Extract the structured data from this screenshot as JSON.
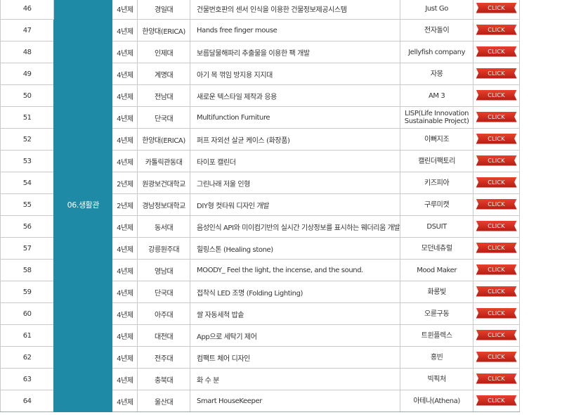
{
  "category": "06.생활관",
  "button_label": "CLICK",
  "rows": [
    {
      "no": "46",
      "grade": "4년제",
      "school": "경일대",
      "title": "건물번호판의 센서 인식을 이용한 건물정보제공시스템",
      "team": "Just Go"
    },
    {
      "no": "47",
      "grade": "4년제",
      "school": "한양대(ERICA)",
      "title": "Hands free finger mouse",
      "team": "전자돌이"
    },
    {
      "no": "48",
      "grade": "4년제",
      "school": "인제대",
      "title": "보름달물해파리 추출물을 이용한 팩 개발",
      "team": "Jellyfish company"
    },
    {
      "no": "49",
      "grade": "4년제",
      "school": "계명대",
      "title": "아기 목 꺾임 방지용 지지대",
      "team": "자몽"
    },
    {
      "no": "50",
      "grade": "4년제",
      "school": "전남대",
      "title": "새로운 텍스타일 제작과 응용",
      "team": "AM 3"
    },
    {
      "no": "51",
      "grade": "4년제",
      "school": "단국대",
      "title": "Multifunction Furniture",
      "team": "LISP(Life Innovation Sustainable Project)"
    },
    {
      "no": "52",
      "grade": "4년제",
      "school": "한양대(ERICA)",
      "title": "퍼프 자외선 살균 케이스 (화장품)",
      "team": "이뻐지조"
    },
    {
      "no": "53",
      "grade": "4년제",
      "school": "카톨릭관동대",
      "title": "타이포 캘린더",
      "team": "캘린더팩토리"
    },
    {
      "no": "54",
      "grade": "2년제",
      "school": "원광보건대학교",
      "title": "그린나래 저울 인형",
      "team": "키즈피아"
    },
    {
      "no": "55",
      "grade": "2년제",
      "school": "경남정보대학교",
      "title": "DIY형 컷타워 디자인 개발",
      "team": "구루미캣"
    },
    {
      "no": "56",
      "grade": "4년제",
      "school": "동서대",
      "title": "음성인식 API와 미이컴기반의 실시간 기상정보를 표시하는 웨더리움 개발",
      "team": "DSUIT"
    },
    {
      "no": "57",
      "grade": "4년제",
      "school": "강릉원주대",
      "title": "힐링스톤 (Healing stone)",
      "team": "모던네츄럴"
    },
    {
      "no": "58",
      "grade": "4년제",
      "school": "영남대",
      "title": "MOODY_ Feel the light, the incense, and the sound.",
      "team": "Mood Maker"
    },
    {
      "no": "59",
      "grade": "4년제",
      "school": "단국대",
      "title": "접착식 LED 조명 (Folding Lighting)",
      "team": "화롱빛"
    },
    {
      "no": "60",
      "grade": "4년제",
      "school": "아주대",
      "title": "쌀 자동세척 밥솥",
      "team": "오륜구동"
    },
    {
      "no": "61",
      "grade": "4년제",
      "school": "대전대",
      "title": "App으로 세탁기 제어",
      "team": "트윈플렉스"
    },
    {
      "no": "62",
      "grade": "4년제",
      "school": "전주대",
      "title": "컴팩트 체어 디자인",
      "team": "홍빈"
    },
    {
      "no": "63",
      "grade": "4년제",
      "school": "충북대",
      "title": "화 수 분",
      "team": "빅픽처"
    },
    {
      "no": "64",
      "grade": "4년제",
      "school": "울산대",
      "title": "Smart HouseKeeper",
      "team": "아테나(Athena)"
    }
  ]
}
